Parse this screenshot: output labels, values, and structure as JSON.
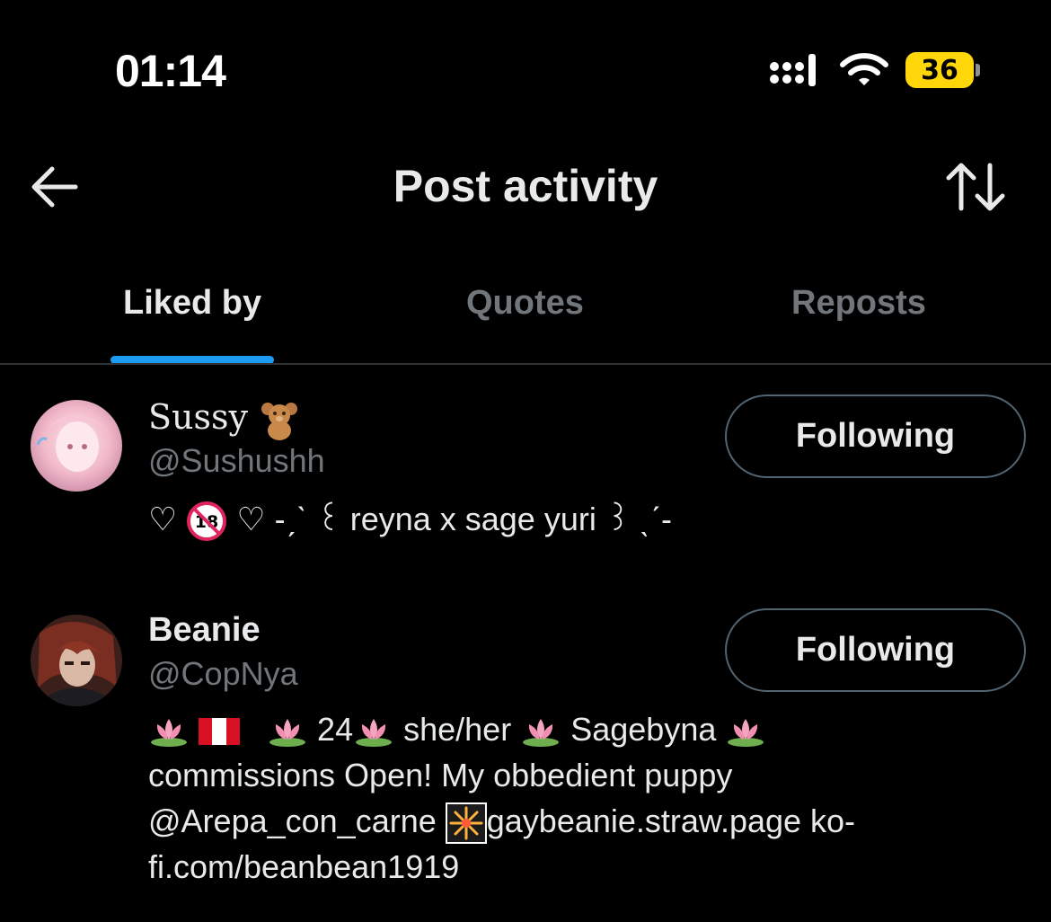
{
  "status_bar": {
    "time": "01:14",
    "battery_level": "36",
    "battery_color": "#ffd60a"
  },
  "header": {
    "title": "Post activity",
    "back_icon": "arrow-left-icon",
    "sort_icon": "sort-arrows-icon"
  },
  "tabs": [
    {
      "label": "Liked by",
      "active": true
    },
    {
      "label": "Quotes",
      "active": false
    },
    {
      "label": "Reposts",
      "active": false
    }
  ],
  "accent_color": "#1d9bf0",
  "users": [
    {
      "display_name": "Sussy",
      "name_emoji": "teddy-bear",
      "handle": "@Sushushh",
      "button_label": "Following",
      "bio_parts": [
        "♡",
        "no-under-18-icon",
        "♡",
        "-ˏˋ ꒰ reyna x sage yuri ꒱ ˎˊ-"
      ]
    },
    {
      "display_name": "Beanie",
      "handle": "@CopNya",
      "button_label": "Following",
      "bio_parts": [
        "lotus-icon",
        "peru-flag-icon",
        "lotus-icon",
        "24",
        "lotus-icon",
        "she/her",
        "lotus-icon",
        "Sagebyna",
        "lotus-icon"
      ],
      "bio_line2": "commissions Open! My obbedient puppy",
      "bio_line3_a": "@Arepa_con_carne",
      "bio_line3_b": "gaybeanie.straw.page ko-",
      "bio_line4": "fi.com/beanbean1919"
    }
  ]
}
